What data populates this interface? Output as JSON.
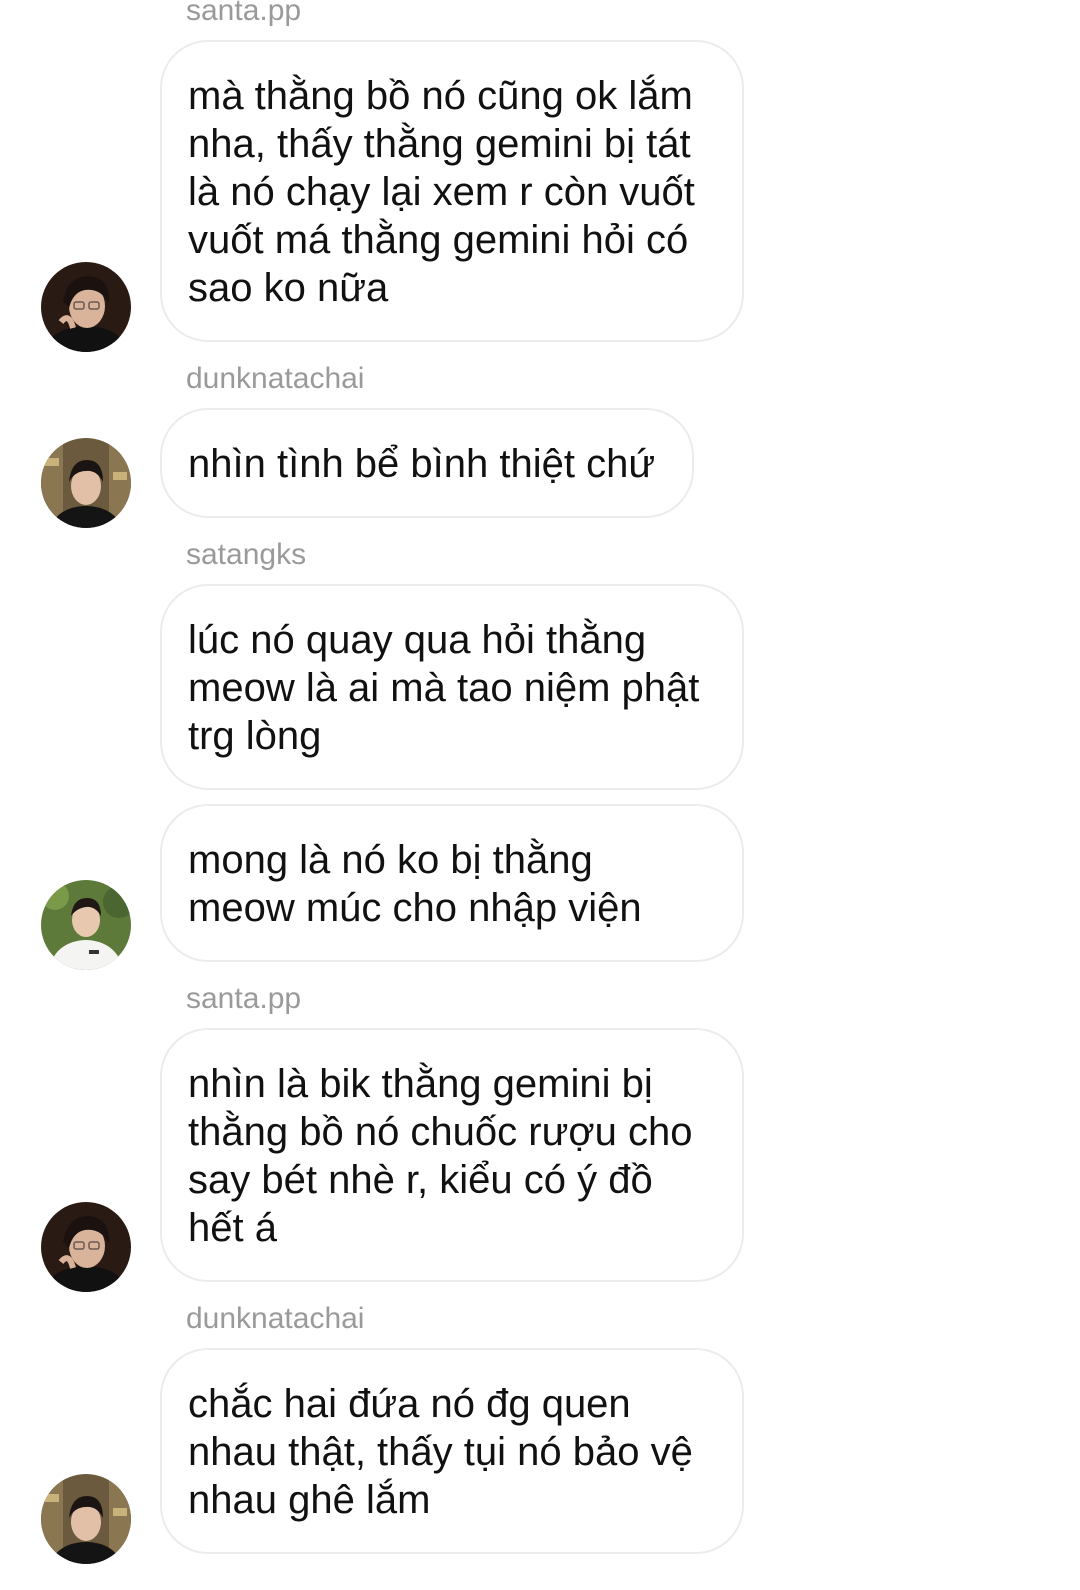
{
  "messages": [
    {
      "sender": "santa.pp",
      "bubbles": [
        "mà thằng bồ nó cũng ok lắm\nnha, thấy thằng gemini bị tát\nlà nó chạy lại xem r còn vuốt\nvuốt má thằng gemini hỏi có\nsao ko nữa"
      ]
    },
    {
      "sender": "dunknatachai",
      "bubbles": [
        "nhìn tình bể bình thiệt chứ"
      ]
    },
    {
      "sender": "satangks",
      "bubbles": [
        "lúc nó quay qua hỏi thằng\nmeow là ai mà tao niệm phật\ntrg lòng",
        "mong là nó ko bị thằng\nmeow múc cho nhập viện"
      ]
    },
    {
      "sender": "santa.pp",
      "bubbles": [
        "nhìn là bik thằng gemini bị\nthằng bồ nó chuốc rượu cho\nsay bét nhè r, kiểu có ý đồ\nhết á"
      ]
    },
    {
      "sender": "dunknatachai",
      "bubbles": [
        "chắc hai đứa nó đg quen\nnhau thật, thấy tụi nó bảo vệ\nnhau ghê lắm"
      ]
    }
  ]
}
